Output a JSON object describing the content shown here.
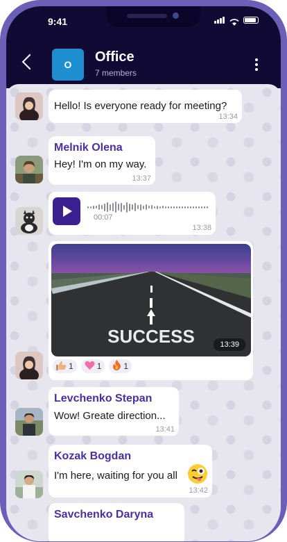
{
  "status_bar": {
    "time": "9:41"
  },
  "header": {
    "avatar_letter": "O",
    "title": "Office",
    "subtitle": "7 members"
  },
  "messages": [
    {
      "text": "Hello! Is everyone ready for meeting?",
      "time": "13:34"
    },
    {
      "name": "Melnik Olena",
      "text": "Hey! I'm on my way.",
      "time": "13:37"
    },
    {
      "voice_duration": "00:07",
      "time": "13:38"
    },
    {
      "photo_caption": "SUCCESS",
      "time": "13:39",
      "reactions": [
        {
          "icon": "thumbs-up-icon",
          "count": "1"
        },
        {
          "icon": "heart-icon",
          "count": "1"
        },
        {
          "icon": "fire-icon",
          "count": "1"
        }
      ]
    },
    {
      "name": "Levchenko Stepan",
      "text": "Wow! Greate direction...",
      "time": "13:41"
    },
    {
      "name": "Kozak Bogdan",
      "text": "I'm here, waiting for you all",
      "time": "13:42"
    },
    {
      "name": "Savchenko Daryna"
    }
  ],
  "colors": {
    "header_bg": "#100a34",
    "accent": "#4b2fa0",
    "frame": "#6c5fb8",
    "group_avatar": "#1d8fd1"
  }
}
